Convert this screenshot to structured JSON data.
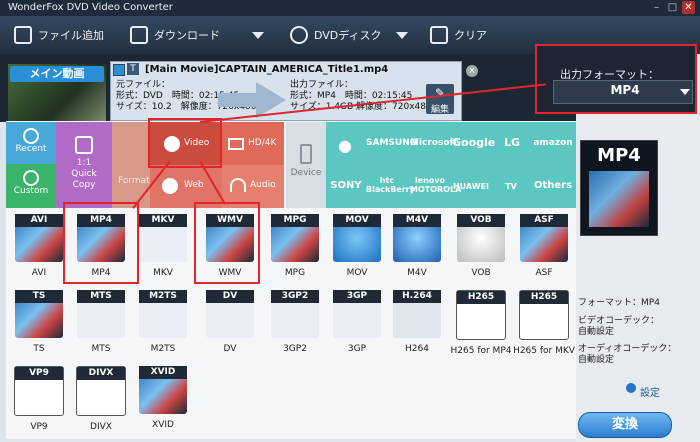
{
  "window": {
    "title": "WonderFox DVD Video Converter"
  },
  "toolbar": {
    "add_file": "ファイル追加",
    "download": "ダウンロード",
    "dvd": "DVDディスク",
    "clear": "クリア"
  },
  "task": {
    "badge": "メイン動画",
    "title": "[Main Movie]CAPTAIN_AMERICA_Title1.mp4",
    "src_label": "元ファイル：",
    "src_line1": "形式：DVD　時間：02:15:45",
    "src_line2": "サイズ：10.2　解像度：720x480",
    "out_label": "出力ファイル：",
    "out_line1": "形式：MP4　時間：02:15:45",
    "out_line2": "サイズ：1.4GB 解像度：720x480",
    "edit": "編集"
  },
  "output": {
    "label": "出力フォーマット：",
    "value": "MP4"
  },
  "categories": {
    "recent": "Recent",
    "custom": "Custom",
    "quick_copy": "1:1\nQuick\nCopy",
    "format": "Format",
    "video": "Video",
    "hd4k": "HD/4K",
    "web": "Web",
    "audio": "Audio",
    "device": "Device"
  },
  "brands": [
    "SAMSUNG",
    "Microsoft",
    "Google",
    "LG",
    "amazon",
    "SONY",
    "htc BlackBerry",
    "lenovo MOTOROLA",
    "HUAWEI",
    "TV",
    "Others"
  ],
  "formats": {
    "row1": [
      "AVI",
      "MP4",
      "MKV",
      "WMV",
      "MPG",
      "MOV",
      "M4V",
      "VOB",
      "ASF"
    ],
    "row2": [
      "TS",
      "MTS",
      "M2TS",
      "DV",
      "3GP2",
      "3GP",
      "H264",
      "H265 for MP4",
      "H265 for MKV"
    ],
    "row3": [
      "VP9",
      "DIVX",
      "XVID"
    ],
    "tags2": [
      "TS",
      "MTS",
      "M2TS",
      "DV",
      "3GP2",
      "3GP",
      "H.264",
      "H265",
      "H265"
    ]
  },
  "details": {
    "format": "フォーマット：MP4",
    "vcodec1": "ビデオコーデック：",
    "vcodec2": "自動設定",
    "acodec1": "オーディオコーデック：",
    "acodec2": "自動設定",
    "settings": "設定",
    "convert": "変換"
  },
  "colors": {
    "accent": "#2a8fd6",
    "highlight": "#e2242b",
    "video_cat": "#cc5a4c",
    "device_cat": "#5cc6c0"
  }
}
